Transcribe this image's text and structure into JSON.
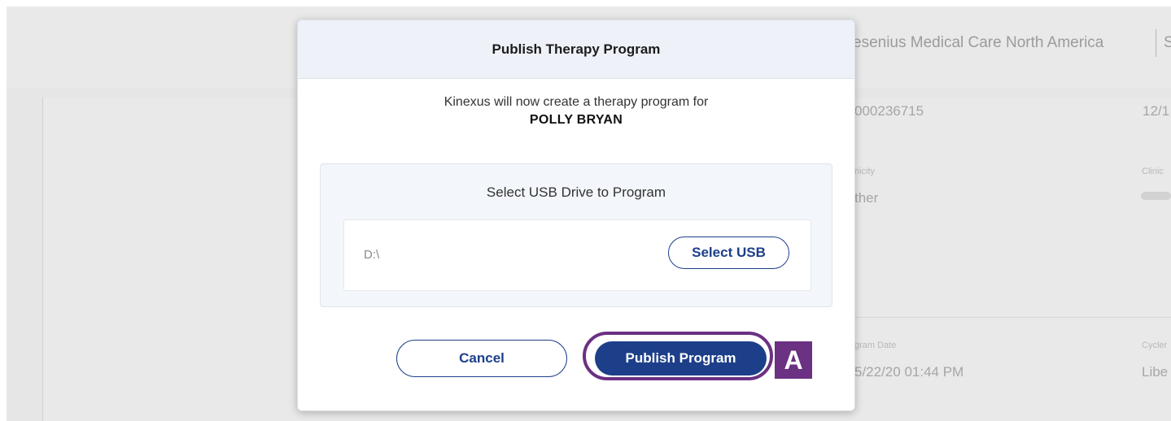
{
  "background": {
    "organization": "esenius Medical Care North America",
    "organization_trail": "S",
    "patient_id": "000236715",
    "date_partial": "12/1",
    "ethnicity_label": "nicity",
    "ethnicity_value": "ther",
    "clinic_label": "Clinic",
    "program_date_label": "gram Date",
    "program_date_value": "5/22/20 01:44 PM",
    "cycler_label": "Cycler",
    "cycler_value": "Libe"
  },
  "modal": {
    "title": "Publish Therapy Program",
    "intro": "Kinexus will now create a therapy program for",
    "patient_name": "POLLY BRYAN",
    "usb_section_title": "Select USB Drive to Program",
    "drive_value": "D:\\",
    "select_usb_label": "Select USB",
    "cancel_label": "Cancel",
    "publish_label": "Publish Program"
  },
  "annotation": {
    "callout_label": "A",
    "color": "#6b3183"
  },
  "colors": {
    "primary": "#1d3f8a",
    "header_bg": "#eef2f8"
  }
}
